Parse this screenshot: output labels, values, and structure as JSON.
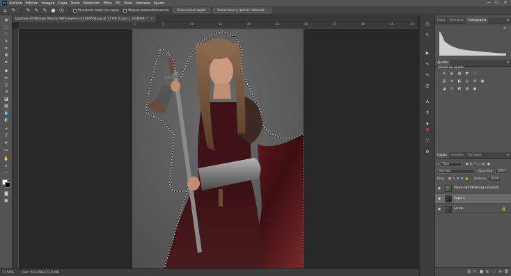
{
  "menubar": {
    "items": [
      "Archivo",
      "Edición",
      "Imagen",
      "Capa",
      "Texto",
      "Selección",
      "Filtro",
      "3D",
      "Vista",
      "Ventana",
      "Ayuda"
    ],
    "window_controls": [
      "—",
      "□",
      "✕"
    ]
  },
  "options_bar": {
    "sample_all_layers_label": "Muestrear todas las capas",
    "auto_enhance_label": "Mejorar automáticamente",
    "select_subject_label": "Seleccionar sujeto",
    "select_and_mask_label": "Seleccionar y aplicar máscara..."
  },
  "document": {
    "tab_title": "bigstock-Elf-Woman-Warrior-With-Sword-I-23284658.jpg al 17,6% (Capa 1, RGB/8#) *",
    "close": "×"
  },
  "ruler": {
    "top_ticks": [
      "0",
      "5",
      "10",
      "15",
      "20",
      "25",
      "30",
      "35",
      "40",
      "45",
      "50"
    ]
  },
  "status": {
    "zoom": "17,59%",
    "doc_info": "Doc: 50,8 MB/172,6 MB"
  },
  "panels": {
    "top_tabs": [
      "Color",
      "Muestras",
      "Histograma"
    ],
    "top_active_tab": "Histograma",
    "adjust_tab": "Ajustes",
    "adjust_add_label": "Añadir un ajuste",
    "layers_tabs": [
      "Capas",
      "Canales",
      "Trazados"
    ],
    "layers_active_tab": "Capas",
    "kind_filter": "Tipo",
    "blend_mode": "Normal",
    "opacity_label": "Opacidad:",
    "opacity_value": "100%",
    "lock_label": "Bloq.:",
    "fill_label": "Relleno:",
    "fill_value": "100%",
    "layers": [
      {
        "name": "steve-n8CF8IkBs3g-unsplash",
        "selected": false
      },
      {
        "name": "Capa 1",
        "selected": true
      },
      {
        "name": "Fondo",
        "selected": false
      }
    ]
  }
}
